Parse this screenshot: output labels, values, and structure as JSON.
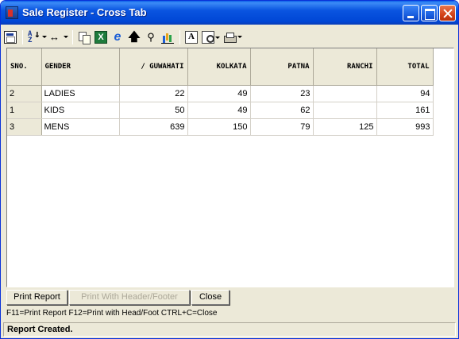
{
  "window": {
    "title": "Sale Register - Cross Tab"
  },
  "toolbar": {
    "icons": [
      "window-icon",
      "sort-az-icon",
      "column-width-icon",
      "copy-icon",
      "excel-icon",
      "internet-explorer-icon",
      "up-arrow-icon",
      "find-icon",
      "chart-icon",
      "font-icon",
      "print-preview-icon",
      "printer-icon"
    ]
  },
  "grid": {
    "columns": [
      "SNO.",
      "GENDER",
      "/ GUWAHATI",
      "KOLKATA",
      "PATNA",
      "RANCHI",
      "TOTAL"
    ],
    "rows": [
      {
        "sno": "2",
        "gender": "LADIES",
        "guwahati": "22",
        "kolkata": "49",
        "patna": "23",
        "ranchi": "",
        "total": "94"
      },
      {
        "sno": "1",
        "gender": "KIDS",
        "guwahati": "50",
        "kolkata": "49",
        "patna": "62",
        "ranchi": "",
        "total": "161"
      },
      {
        "sno": "3",
        "gender": "MENS",
        "guwahati": "639",
        "kolkata": "150",
        "patna": "79",
        "ranchi": "125",
        "total": "993"
      }
    ]
  },
  "buttons": {
    "print_report": "Print Report",
    "print_header_footer": "Print With Header/Footer",
    "close": "Close"
  },
  "hint": "F11=Print Report  F12=Print with Head/Foot  CTRL+C=Close",
  "status": "Report Created."
}
